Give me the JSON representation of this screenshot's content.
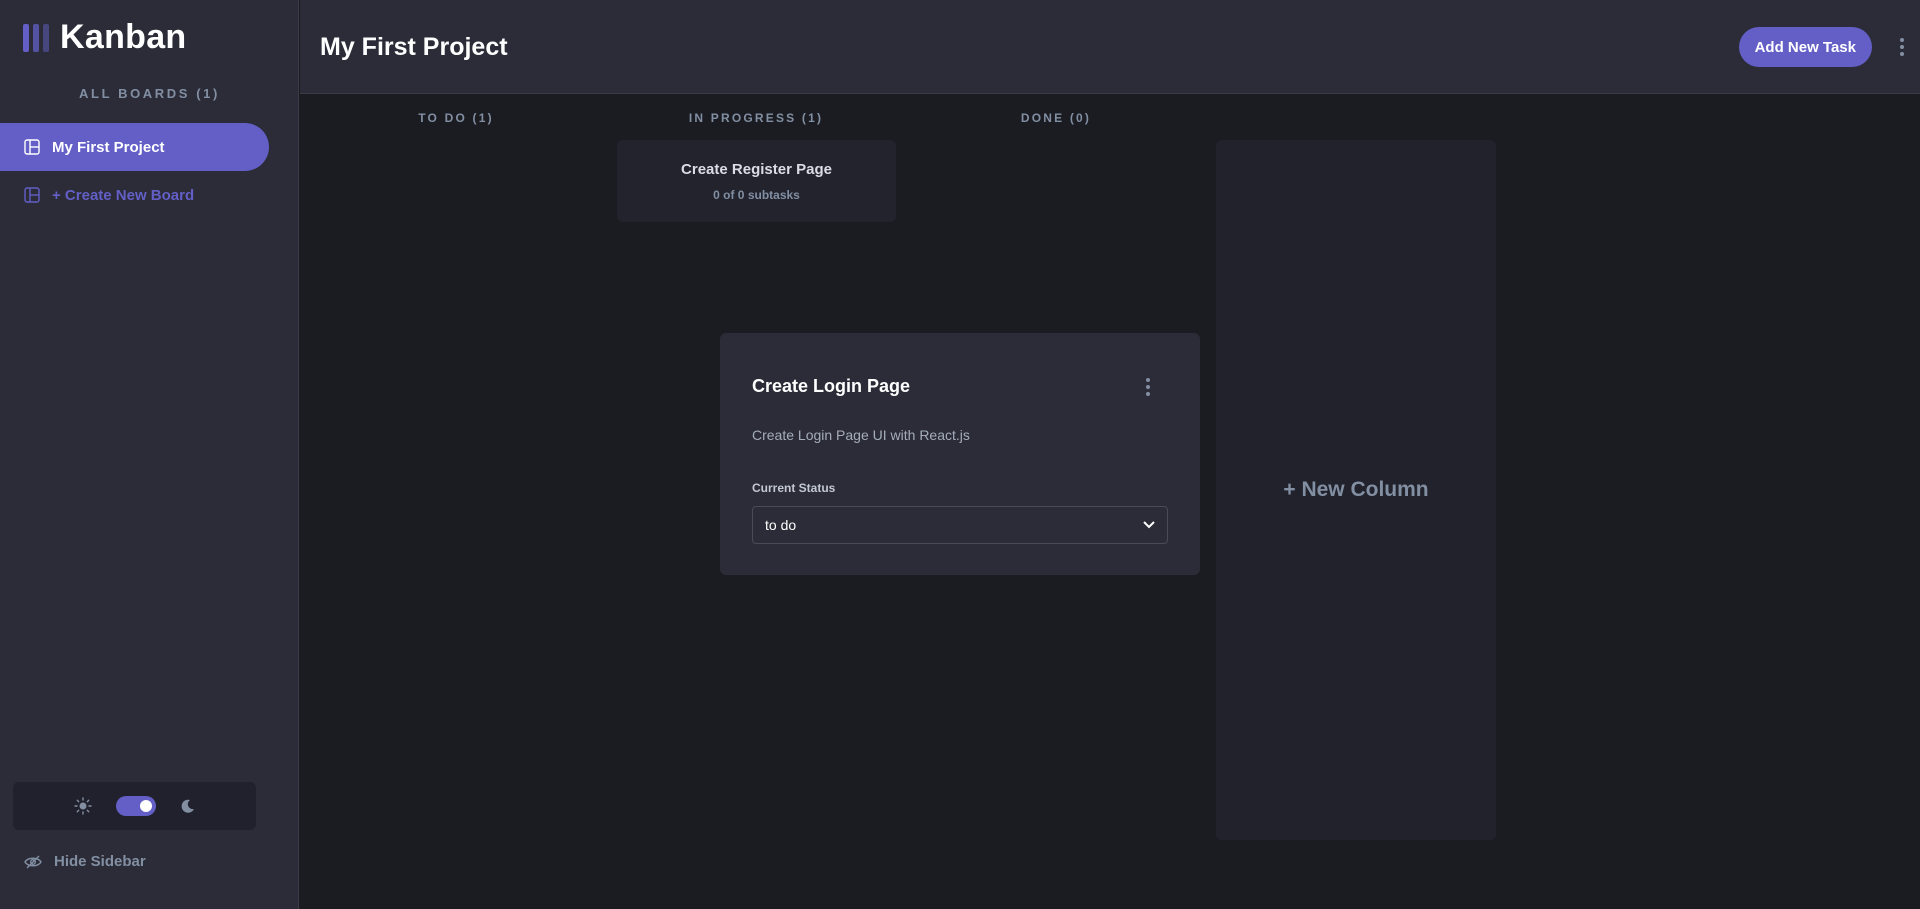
{
  "app": {
    "name": "Kanban"
  },
  "sidebar": {
    "boards_heading": "ALL BOARDS (1)",
    "boards": [
      {
        "label": "My First Project",
        "active": true
      }
    ],
    "create_board_label": "+ Create New Board",
    "theme": {
      "mode": "dark"
    },
    "hide_sidebar_label": "Hide Sidebar"
  },
  "header": {
    "title": "My First Project",
    "add_task_label": "Add New Task"
  },
  "board": {
    "columns": [
      {
        "heading": "TO DO (1)"
      },
      {
        "heading": "IN PROGRESS (1)"
      },
      {
        "heading": "DONE (0)"
      }
    ],
    "cards": [
      {
        "title": "Create Register Page",
        "subtasks": "0 of 0 subtasks"
      }
    ],
    "new_column_label": "+ New Column"
  },
  "modal": {
    "title": "Create Login Page",
    "description": "Create Login Page UI with React.js",
    "status_label": "Current Status",
    "status_value": "to do"
  },
  "colors": {
    "accent": "#635fc7",
    "sidebar_bg": "#2b2c37",
    "board_bg": "#1b1c22",
    "muted_text": "#828fa3"
  }
}
